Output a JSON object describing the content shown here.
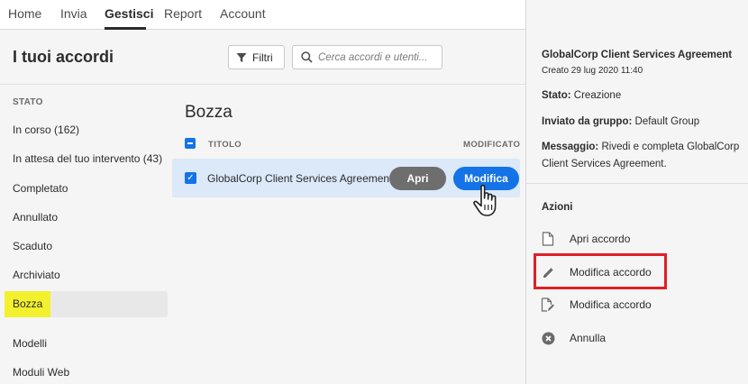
{
  "nav": {
    "tabs": [
      {
        "label": "Home"
      },
      {
        "label": "Invia"
      },
      {
        "label": "Gestisci"
      },
      {
        "label": "Report"
      },
      {
        "label": "Account"
      }
    ],
    "active_tab": "Gestisci"
  },
  "header": {
    "page_title": "I tuoi accordi",
    "filter_label": "Filtri",
    "search_placeholder": "Cerca accordi e utenti..."
  },
  "sidebar": {
    "section_label": "STATO",
    "items": [
      {
        "label": "In corso (162)"
      },
      {
        "label": "In attesa del tuo intervento (43)"
      },
      {
        "label": "Completato"
      },
      {
        "label": "Annullato"
      },
      {
        "label": "Scaduto"
      },
      {
        "label": "Archiviato"
      },
      {
        "label": "Bozza"
      },
      {
        "label": "Modelli"
      },
      {
        "label": "Moduli Web"
      }
    ],
    "selected": "Bozza",
    "highlight_color": "#f3f02e"
  },
  "list": {
    "title": "Bozza",
    "columns": {
      "title": "TITOLO",
      "modified": "MODIFICATO"
    },
    "rows": [
      {
        "title": "GlobalCorp Client Services Agreement",
        "open_label": "Apri",
        "edit_label": "Modifica"
      }
    ]
  },
  "details": {
    "title": "GlobalCorp Client Services Agreement",
    "created": "Creato 29 lug 2020 11:40",
    "status_label": "Stato:",
    "status_value": "Creazione",
    "group_label": "Inviato da gruppo:",
    "group_value": "Default Group",
    "message_label": "Messaggio:",
    "message_value": "Rivedi e completa GlobalCorp Client Services Agreement.",
    "actions_label": "Azioni",
    "actions": [
      {
        "label": "Apri accordo",
        "icon": "document-icon"
      },
      {
        "label": "Modifica accordo",
        "icon": "pencil-icon"
      },
      {
        "label": "Modifica accordo",
        "icon": "document-edit-icon"
      },
      {
        "label": "Annulla",
        "icon": "cancel-circle-icon"
      }
    ]
  },
  "colors": {
    "accent": "#1473e6",
    "secondary_button": "#6e6e6e",
    "selected_row": "#dbe9f9",
    "callout_border": "#e01f26"
  }
}
